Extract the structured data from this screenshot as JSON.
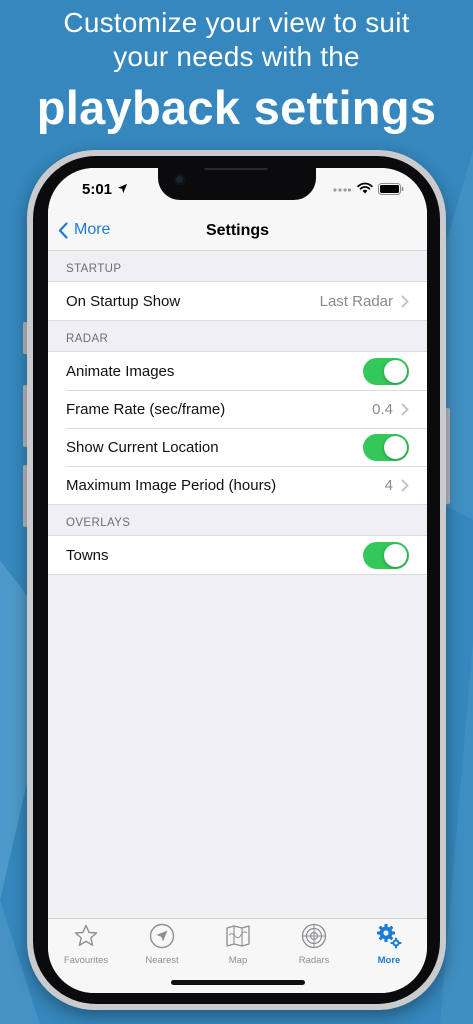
{
  "headline": {
    "line1": "Customize your view to suit",
    "line2": "your needs with the",
    "line3": "playback settings"
  },
  "status_bar": {
    "time": "5:01"
  },
  "nav": {
    "back_label": "More",
    "title": "Settings"
  },
  "sections": {
    "startup": {
      "header": "STARTUP",
      "on_startup_show": {
        "label": "On Startup Show",
        "value": "Last Radar"
      }
    },
    "radar": {
      "header": "RADAR",
      "animate_images": {
        "label": "Animate Images",
        "on": true
      },
      "frame_rate": {
        "label": "Frame Rate (sec/frame)",
        "value": "0.4"
      },
      "show_location": {
        "label": "Show Current Location",
        "on": true
      },
      "max_period": {
        "label": "Maximum Image Period (hours)",
        "value": "4"
      }
    },
    "overlays": {
      "header": "OVERLAYS",
      "towns": {
        "label": "Towns",
        "on": true
      }
    }
  },
  "tabs": [
    {
      "label": "Favourites",
      "icon": "star-icon"
    },
    {
      "label": "Nearest",
      "icon": "location-arrow-icon"
    },
    {
      "label": "Map",
      "icon": "map-icon"
    },
    {
      "label": "Radars",
      "icon": "radar-target-icon"
    },
    {
      "label": "More",
      "icon": "gears-icon",
      "active": true
    }
  ],
  "colors": {
    "background": "#3587bd",
    "accent": "#1d7bd8",
    "toggle_on": "#34c759"
  }
}
